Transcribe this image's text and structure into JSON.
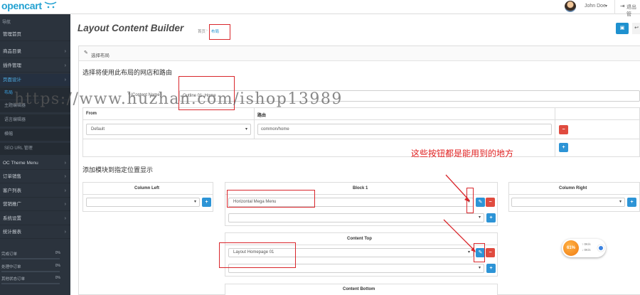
{
  "brand": {
    "logo_text": "opencart"
  },
  "user": {
    "name": "John Doe",
    "caret": "▾",
    "logout_label": "退出管"
  },
  "sidebar": {
    "heading": "导航",
    "items": [
      {
        "label": "管理首页"
      },
      {
        "label": "商品目录"
      },
      {
        "label": "插件管理"
      },
      {
        "label": "页面设计"
      },
      {
        "label": "布局"
      },
      {
        "label": "主题编辑器"
      },
      {
        "label": "语言编辑器"
      },
      {
        "label": "横幅"
      },
      {
        "label": "SEO URL 管理"
      },
      {
        "label": "OC Theme Menu"
      },
      {
        "label": "订单销售"
      },
      {
        "label": "客户列表"
      },
      {
        "label": "营销推广"
      },
      {
        "label": "系统设置"
      },
      {
        "label": "统计报表"
      }
    ],
    "stats": [
      {
        "label": "完成订单",
        "value": "0%"
      },
      {
        "label": "处理中订单",
        "value": "0%"
      },
      {
        "label": "其他状态订单",
        "value": "0%"
      }
    ]
  },
  "header": {
    "title": "Layout Content Builder",
    "breadcrumb": {
      "home": "首页",
      "separator": "›",
      "current": "布局"
    }
  },
  "panel": {
    "title": "选择布局",
    "store_route_heading": "选择将使用此布局的网店和路由",
    "name_label": "* (Content Name)",
    "name_value": "Outline 01: Home",
    "store_table": {
      "col_from": "From",
      "col_route": "路由",
      "from_value": "Default",
      "route_value": "common/home"
    },
    "modules_heading": "添加模块到指定位置显示",
    "column_left": "Column Left",
    "block1": "Block 1",
    "block1_selected": "Horizontal Mega Menu",
    "column_right": "Column Right",
    "content_top": "Content Top",
    "content_top_selected": "Layout Homepage 01",
    "content_bottom": "Content Bottom"
  },
  "annotation": {
    "text": "这些按钮都是能用到的地方",
    "color": "#e02020"
  },
  "watermark": "https://www.huzhan.com/ishop13989",
  "speed_widget": {
    "percent": "61%",
    "up": "↑ 0K/s",
    "down": "↓ 0K/s"
  },
  "colors": {
    "accent": "#1e91cf",
    "sidebar_bg": "#2b333d",
    "danger": "#e04b3f"
  }
}
